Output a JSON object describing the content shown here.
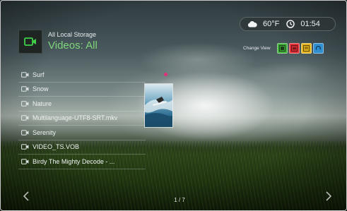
{
  "header": {
    "source": "All Local Storage",
    "title": "Videos: All",
    "app_icon": "video-camera-icon"
  },
  "status": {
    "weather_icon": "cloud-icon",
    "temperature": "60°F",
    "clock_icon": "clock-icon",
    "time": "01:54"
  },
  "change_view": {
    "label": "Change View",
    "buttons": [
      {
        "icon": "grid-view-icon",
        "color": "#3fae3a"
      },
      {
        "icon": "list-view-icon",
        "color": "#e23036"
      },
      {
        "icon": "detail-view-icon",
        "color": "#e6b41e"
      },
      {
        "icon": "reload-icon",
        "color": "#2f8fd0"
      }
    ]
  },
  "files": [
    {
      "label": "Surf",
      "icon": "video-file-icon"
    },
    {
      "label": "Snow",
      "icon": "video-file-icon"
    },
    {
      "label": "Nature",
      "icon": "video-file-icon"
    },
    {
      "label": "Multilanguage-UTF8-SRT.mkv",
      "icon": "video-file-icon"
    },
    {
      "label": "Serenity",
      "icon": "video-file-icon"
    },
    {
      "label": "VIDEO_TS.VOB",
      "icon": "video-file-icon"
    },
    {
      "label": "Birdy The Mighty Decode - ...",
      "icon": "video-file-icon"
    }
  ],
  "thumbnail": {
    "icon": "surf-thumbnail"
  },
  "footer": {
    "page": "1 / 7",
    "prev_icon": "chevron-left-icon",
    "next_icon": "chevron-right-icon"
  },
  "colors": {
    "title_green": "#7fd67a",
    "selection_dot": "#e0307a"
  }
}
